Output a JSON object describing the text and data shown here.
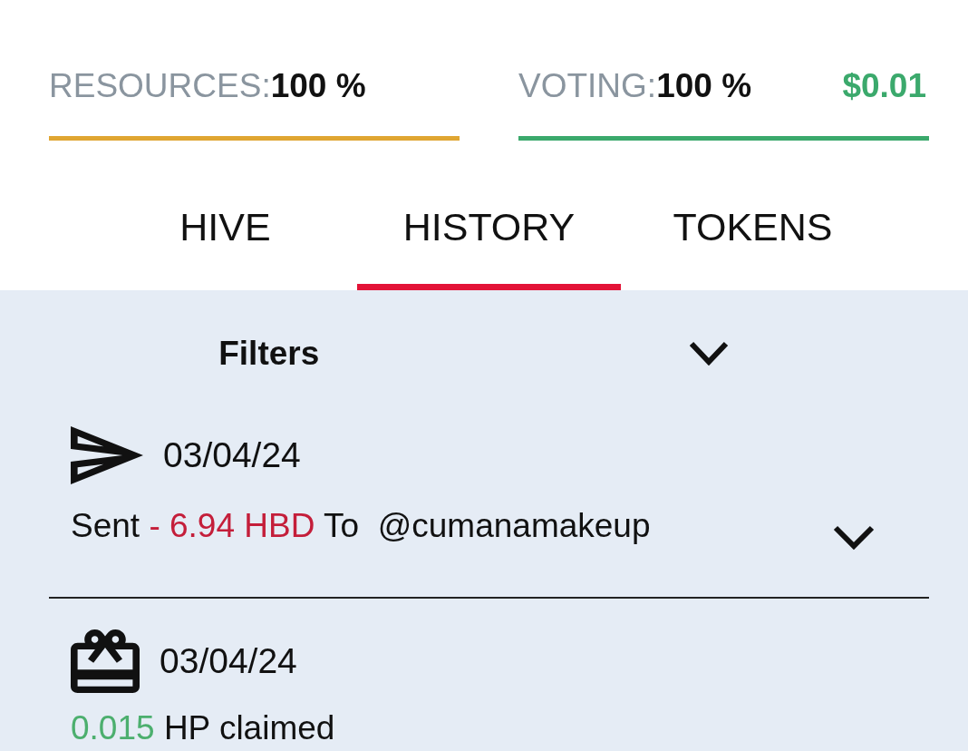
{
  "meters": [
    {
      "label": "RESOURCES:",
      "value": "100 %",
      "level": 1,
      "color": "#e0a632"
    },
    {
      "label": "VOTING:",
      "value": "100 %",
      "amount": "$0.01",
      "level": 1,
      "color": "#3ba96c"
    }
  ],
  "tabs": [
    {
      "label": "HIVE",
      "selected": false
    },
    {
      "label": "HISTORY",
      "selected": true
    },
    {
      "label": "TOKENS",
      "selected": false
    }
  ],
  "filters": {
    "label": "Filters",
    "expanded": false
  },
  "transactions": [
    {
      "kind": "transfer",
      "date": "03/04/24",
      "parts": [
        {
          "text": "Sent",
          "kind": "plain"
        },
        {
          "text": "- 6.94 HBD",
          "kind": "negative"
        },
        {
          "text": "To  @cumanamakeup",
          "kind": "plain"
        }
      ],
      "expanded": false
    },
    {
      "kind": "claim",
      "date": "03/04/24",
      "parts": [
        {
          "text": "0.015",
          "kind": "positive"
        },
        {
          "text": "HP claimed",
          "kind": "plain"
        }
      ]
    }
  ]
}
